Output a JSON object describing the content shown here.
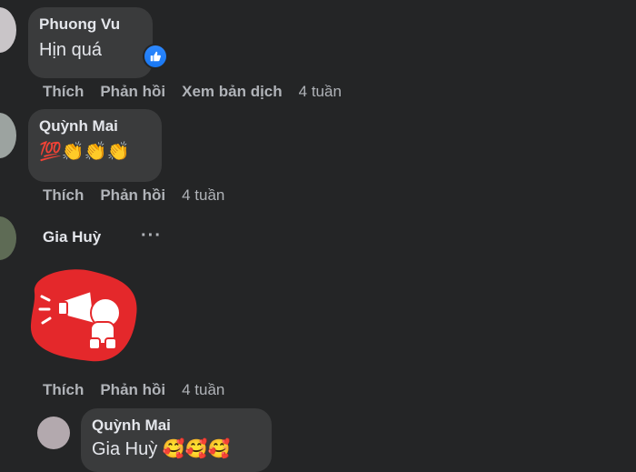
{
  "comments": [
    {
      "author": "Phuong Vu",
      "text": "Hịn quá",
      "actions": {
        "like": "Thích",
        "reply": "Phản hồi",
        "translate": "Xem bản dịch",
        "time": "4 tuần"
      }
    },
    {
      "author": "Quỳnh Mai",
      "emojis": "💯👏👏👏",
      "actions": {
        "like": "Thích",
        "reply": "Phản hồi",
        "time": "4 tuần"
      }
    },
    {
      "author": "Gia Huỳ",
      "more": "···",
      "actions": {
        "like": "Thích",
        "reply": "Phản hồi",
        "time": "4 tuần"
      }
    }
  ],
  "reply": {
    "author": "Quỳnh Mai",
    "text": "Gia Huỳ 🥰🥰🥰"
  },
  "colors": {
    "background": "#242526",
    "bubble": "#3a3b3c",
    "sticker_red": "#e4282b",
    "like_blue": "#1877f2"
  }
}
